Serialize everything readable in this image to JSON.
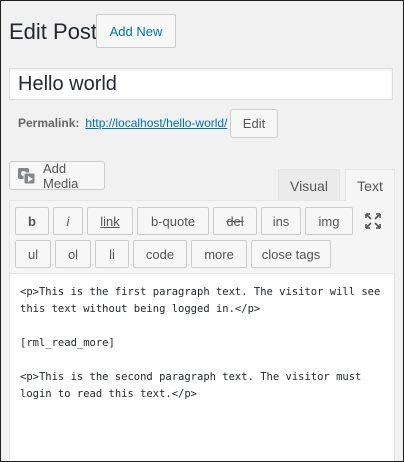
{
  "header": {
    "title": "Edit Post",
    "add_new_label": "Add New"
  },
  "post": {
    "title_value": "Hello world",
    "permalink_label": "Permalink:",
    "permalink_url": "http://localhost/hello-world/",
    "edit_label": "Edit"
  },
  "editor": {
    "add_media_label": "Add Media",
    "tabs": {
      "visual": "Visual",
      "text": "Text"
    },
    "quicktags": [
      {
        "label": "b"
      },
      {
        "label": "i"
      },
      {
        "label": "link"
      },
      {
        "label": "b-quote"
      },
      {
        "label": "del"
      },
      {
        "label": "ins"
      },
      {
        "label": "img"
      },
      {
        "label": "ul"
      },
      {
        "label": "ol"
      },
      {
        "label": "li"
      },
      {
        "label": "code"
      },
      {
        "label": "more"
      },
      {
        "label": "close tags"
      }
    ],
    "content": "<p>This is the first paragraph text. The visitor will see this text without being logged in.</p>\n\n[rml_read_more]\n\n<p>This is the second paragraph text. The visitor must login to read this text.</p>"
  },
  "icons": {
    "add_media": "media-camera-icon",
    "fullscreen": "fullscreen-expand-icon"
  }
}
